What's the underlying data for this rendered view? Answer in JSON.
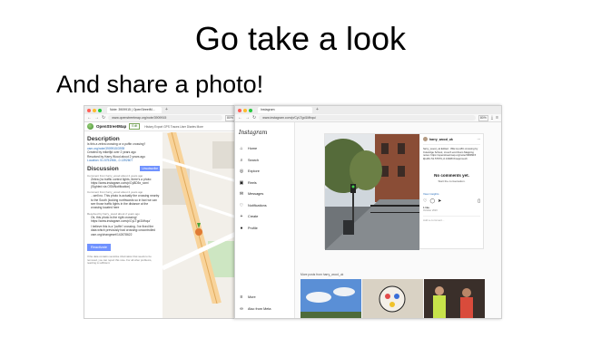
{
  "slide": {
    "title": "Go take a look",
    "subtitle": "And share a photo!"
  },
  "osm": {
    "tab_title": "Note: 3909915 | OpenStreetM...",
    "url": "www.openstreetmap.org/note/3909915",
    "zoom": "80%",
    "app_name": "OpenStreetMap",
    "edit_label": "Edit",
    "nav": "History  Export  GPS Traces  User Diaries  More",
    "description_heading": "Description",
    "description_text": "Is this a zebra crossing or a puffin crossing?",
    "via_link": "osm.org/note/3909915/3939",
    "created_by": "Created by mikelfjd over 2 years ago",
    "resolved_by": "Resolved by Harry Wood about 2 years ago",
    "location": "Location: 51.5751966, -0.1392607",
    "discussion_heading": "Discussion",
    "unsubscribe": "Unsubscribe",
    "comment1_meta": "Comment from harry_wood about 2 years ago",
    "comment1_text": "Zebra (no traffic control lights, there's a photo: https://www.instagram.com/p/CyBD5x_sxm/ (Sighted via OSMNotification)",
    "comment2_meta": "Comment from harry_wood about 2 years ago",
    "comment2_text": "...well no. This photo is actually the crossing nearby to the South (looking northwards so in fact we can see those traffic lights in the distance at the crossing located here",
    "comment3_meta": "Resolved by harry_wood about 2 years ago",
    "comment3_text": "Ok, this photo is the right crossing! https://www.instagram.com/p/CyLTgd1Mhqu/",
    "comment4_text": "I believe this is a \"puffin\" crossing. I've fixed the data which previously had crossing=uncontrolled osm.org/changeset/142678622",
    "resolve_label": "Reactivate",
    "footnote": "If the data contains sensitive information that needs to be removed, you can report this note. For all other problems, reacting is sufficient."
  },
  "ig": {
    "tab_title": "Instagram",
    "url": "www.instagram.com/p/CyLTgd1Mhqu/",
    "zoom": "80%",
    "logo": "Instagram",
    "nav": [
      "Home",
      "Search",
      "Explore",
      "Reels",
      "Messages",
      "Notifications",
      "Create",
      "Profile"
    ],
    "nav_icons": [
      "home-icon",
      "search-icon",
      "explore-icon",
      "reels-icon",
      "messages-icon",
      "notifications-icon",
      "create-icon",
      "profile-icon"
    ],
    "more": "More",
    "also_from_meta": "Also from Meta",
    "username": "harry_wood_uk",
    "caption": "harry_wood_uk Edited · 89w A puffin crossing by Coleridge School, crouch end #osm Mapping notes: https://openstreetmap.org/note/3909915 #puffin 51.57679,-0.13928 #mapcrouch",
    "no_comments": "No comments yet.",
    "start_conversation": "Start the conversation.",
    "view_insights": "View insights",
    "likes": "1 like",
    "date": "October 2023",
    "add_comment": "Add a comment...",
    "more_posts": "More posts from harry_wood_uk"
  }
}
